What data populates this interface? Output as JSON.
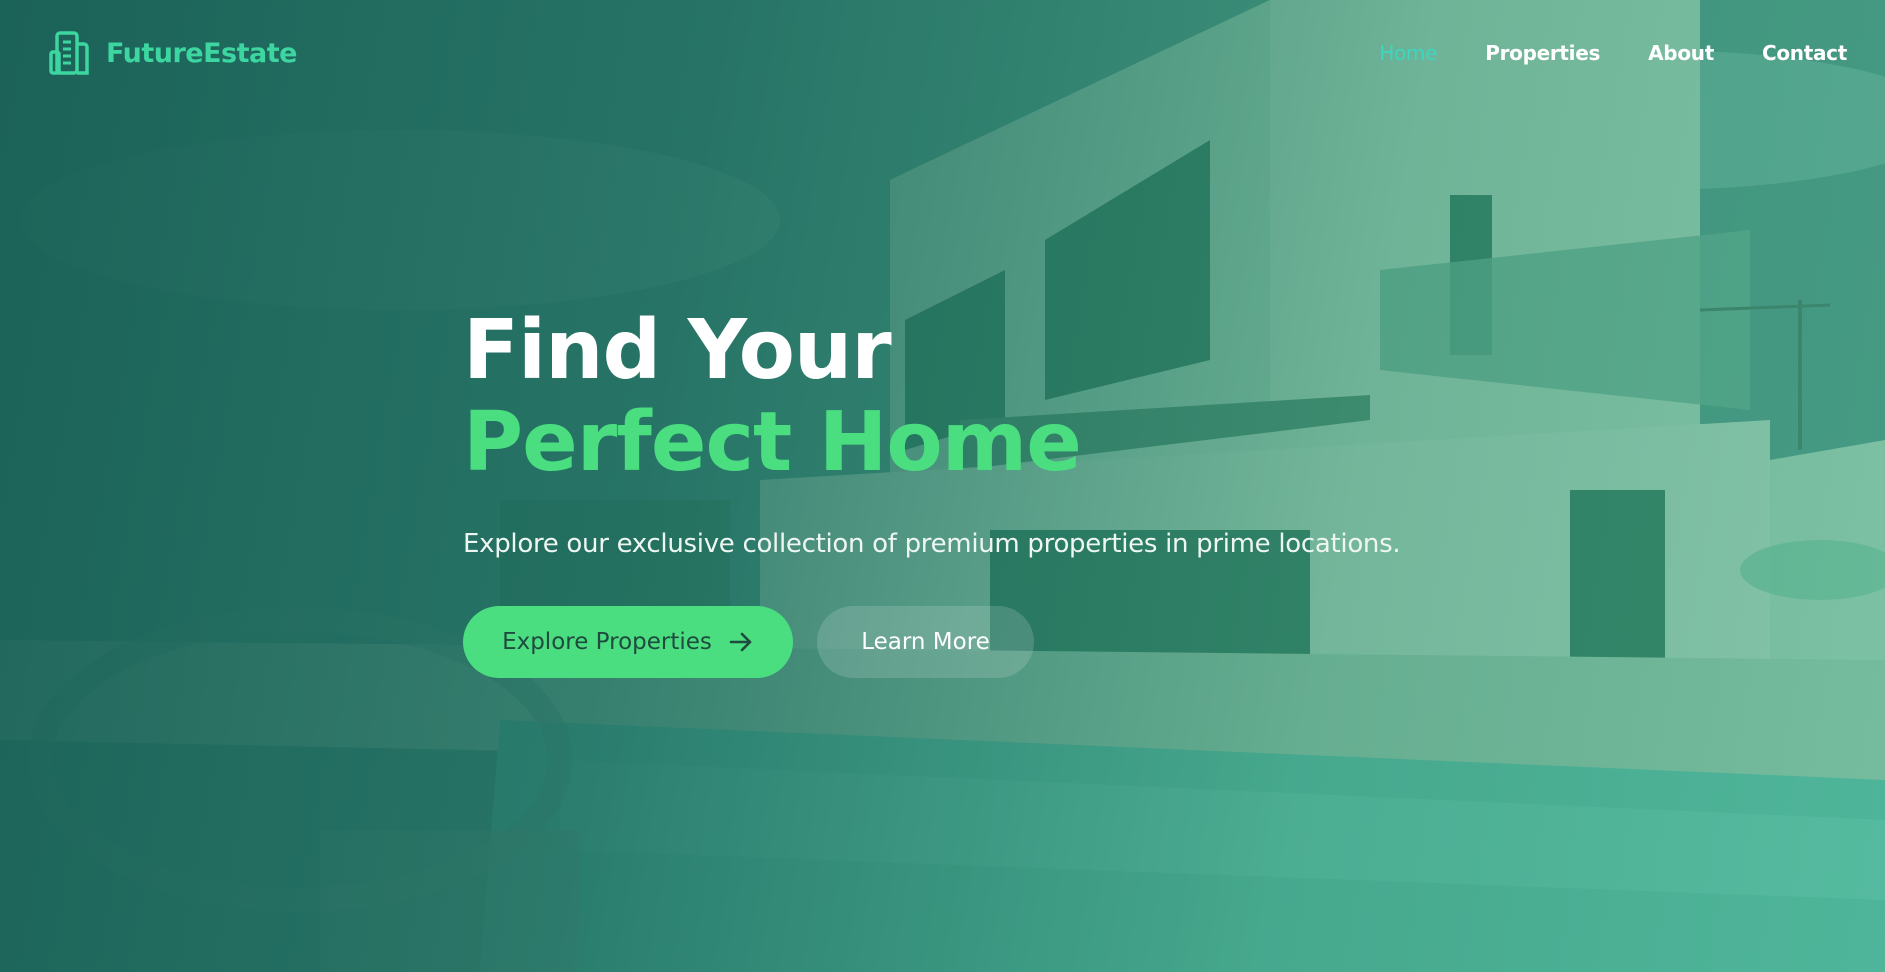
{
  "brand": {
    "name": "FutureEstate",
    "icon": "building-icon"
  },
  "nav": {
    "items": [
      {
        "label": "Home",
        "active": true
      },
      {
        "label": "Properties",
        "active": false
      },
      {
        "label": "About",
        "active": false
      },
      {
        "label": "Contact",
        "active": false
      }
    ]
  },
  "hero": {
    "headline_line1": "Find Your",
    "headline_line2": "Perfect Home",
    "subtitle": "Explore our exclusive collection of premium properties in prime locations.",
    "primary_button": {
      "label": "Explore Properties",
      "icon": "arrow-right-icon"
    },
    "secondary_button": {
      "label": "Learn More"
    }
  },
  "colors": {
    "accent_green": "#4ade80",
    "brand_teal": "#3dd6a0",
    "active_nav": "#3dd6c0",
    "overlay_dark": "#1f6a5e"
  }
}
